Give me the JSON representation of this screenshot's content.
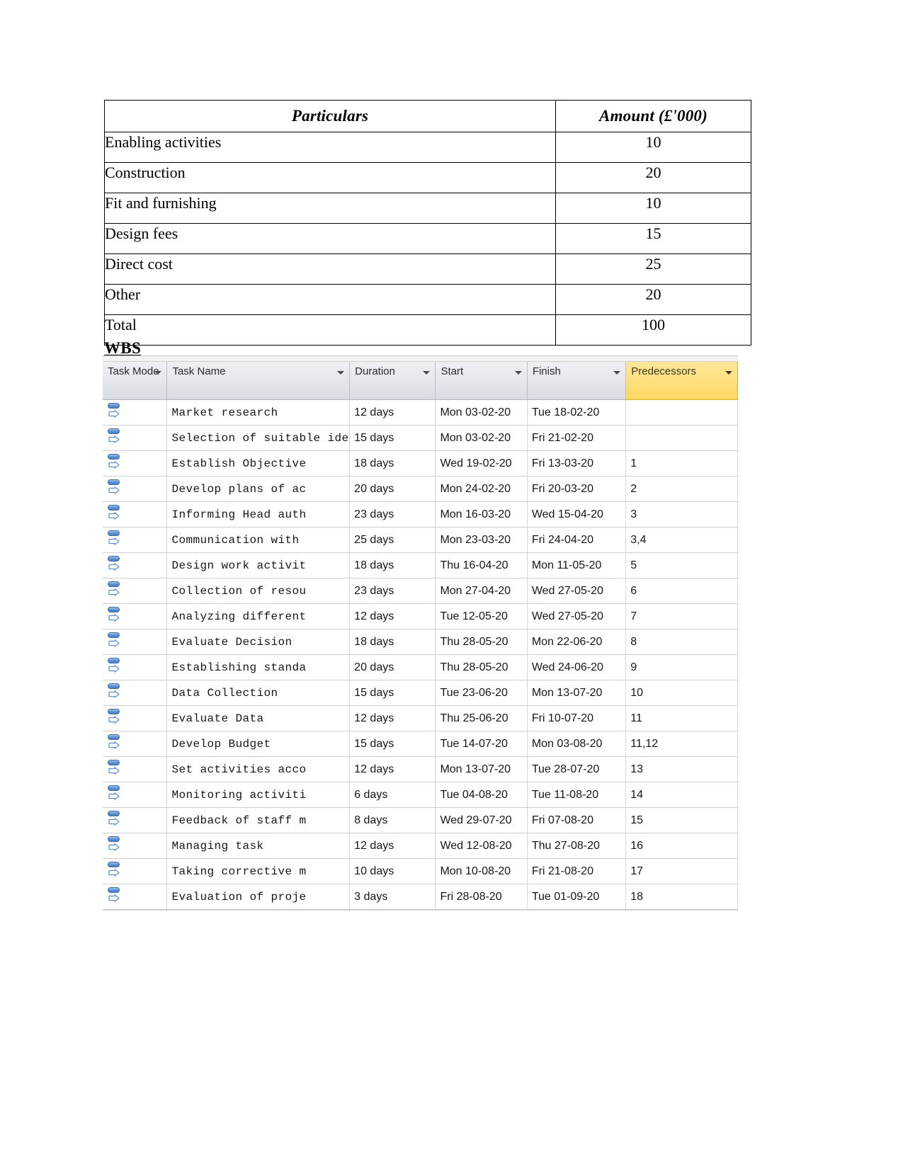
{
  "cost_table": {
    "headers": [
      "Particulars",
      "Amount (£'000)"
    ],
    "rows": [
      {
        "particulars": "Enabling activities",
        "amount": "10"
      },
      {
        "particulars": "Construction",
        "amount": "20"
      },
      {
        "particulars": "Fit and furnishing",
        "amount": "10"
      },
      {
        "particulars": "Design fees",
        "amount": "15"
      },
      {
        "particulars": "Direct cost",
        "amount": "25"
      },
      {
        "particulars": "Other",
        "amount": "20"
      },
      {
        "particulars": "Total",
        "amount": "100"
      }
    ]
  },
  "wbs": {
    "heading": "WBS",
    "colors": {
      "header_background": "#e2e5ea",
      "predecessors_header_background": "#ffde7a",
      "selection_background": "#dde6f3",
      "grid_line": "#d6d6d6"
    },
    "columns": [
      {
        "label": "Task Mode",
        "key": "mode"
      },
      {
        "label": "Task Name",
        "key": "name"
      },
      {
        "label": "Duration",
        "key": "duration"
      },
      {
        "label": "Start",
        "key": "start"
      },
      {
        "label": "Finish",
        "key": "finish"
      },
      {
        "label": "Predecessors",
        "key": "predecessors"
      }
    ],
    "rows": [
      {
        "mode_icon": "auto-scheduled-icon",
        "name": "Market research",
        "duration": "12 days",
        "start": "Mon 03-02-20",
        "finish": "Tue 18-02-20",
        "predecessors": ""
      },
      {
        "mode_icon": "auto-scheduled-icon",
        "name": "Selection of suitable ideas",
        "duration": "15 days",
        "start": "Mon 03-02-20",
        "finish": "Fri 21-02-20",
        "predecessors": ""
      },
      {
        "mode_icon": "auto-scheduled-icon",
        "name": "Establish Objective",
        "duration": "18 days",
        "start": "Wed 19-02-20",
        "finish": "Fri 13-03-20",
        "predecessors": "1"
      },
      {
        "mode_icon": "auto-scheduled-icon",
        "name": "Develop plans of ac",
        "duration": "20 days",
        "start": "Mon 24-02-20",
        "finish": "Fri 20-03-20",
        "predecessors": "2"
      },
      {
        "mode_icon": "auto-scheduled-icon",
        "name": "Informing Head auth",
        "duration": "23 days",
        "start": "Mon 16-03-20",
        "finish": "Wed 15-04-20",
        "predecessors": "3"
      },
      {
        "mode_icon": "auto-scheduled-icon",
        "name": "Communication with",
        "duration": "25 days",
        "start": "Mon 23-03-20",
        "finish": "Fri 24-04-20",
        "predecessors": "3,4"
      },
      {
        "mode_icon": "auto-scheduled-icon",
        "name": "Design work activit",
        "duration": "18 days",
        "start": "Thu 16-04-20",
        "finish": "Mon 11-05-20",
        "predecessors": "5"
      },
      {
        "mode_icon": "auto-scheduled-icon",
        "name": "Collection of resou",
        "duration": "23 days",
        "start": "Mon 27-04-20",
        "finish": "Wed 27-05-20",
        "predecessors": "6"
      },
      {
        "mode_icon": "auto-scheduled-icon",
        "name": "Analyzing different",
        "duration": "12 days",
        "start": "Tue 12-05-20",
        "finish": "Wed 27-05-20",
        "predecessors": "7"
      },
      {
        "mode_icon": "auto-scheduled-icon",
        "name": "Evaluate Decision",
        "duration": "18 days",
        "start": "Thu 28-05-20",
        "finish": "Mon 22-06-20",
        "predecessors": "8"
      },
      {
        "mode_icon": "auto-scheduled-icon",
        "name": "Establishing standa",
        "duration": "20 days",
        "start": "Thu 28-05-20",
        "finish": "Wed 24-06-20",
        "predecessors": "9"
      },
      {
        "mode_icon": "auto-scheduled-icon",
        "name": "Data Collection",
        "duration": "15 days",
        "start": "Tue 23-06-20",
        "finish": "Mon 13-07-20",
        "predecessors": "10"
      },
      {
        "mode_icon": "auto-scheduled-icon",
        "name": "Evaluate Data",
        "duration": "12 days",
        "start": "Thu 25-06-20",
        "finish": "Fri 10-07-20",
        "predecessors": "11"
      },
      {
        "mode_icon": "auto-scheduled-icon",
        "name": "Develop Budget",
        "duration": "15 days",
        "start": "Tue 14-07-20",
        "finish": "Mon 03-08-20",
        "predecessors": "11,12"
      },
      {
        "mode_icon": "auto-scheduled-icon",
        "name": "Set activities acco",
        "duration": "12 days",
        "start": "Mon 13-07-20",
        "finish": "Tue 28-07-20",
        "predecessors": "13"
      },
      {
        "mode_icon": "auto-scheduled-icon",
        "name": "Monitoring activiti",
        "duration": "6 days",
        "start": "Tue 04-08-20",
        "finish": "Tue 11-08-20",
        "predecessors": "14"
      },
      {
        "mode_icon": "auto-scheduled-icon",
        "name": "Feedback of staff m",
        "duration": "8 days",
        "start": "Wed 29-07-20",
        "finish": "Fri 07-08-20",
        "predecessors": "15"
      },
      {
        "mode_icon": "auto-scheduled-icon",
        "name": "Managing task",
        "duration": "12 days",
        "start": "Wed 12-08-20",
        "finish": "Thu 27-08-20",
        "predecessors": "16"
      },
      {
        "mode_icon": "auto-scheduled-icon",
        "name": "Taking corrective m",
        "duration": "10 days",
        "start": "Mon 10-08-20",
        "finish": "Fri 21-08-20",
        "predecessors": "17"
      },
      {
        "mode_icon": "auto-scheduled-icon",
        "name": "Evaluation of proje",
        "duration": "3 days",
        "start": "Fri 28-08-20",
        "finish": "Tue 01-09-20",
        "predecessors": "18",
        "selected_cells": [
          "start",
          "finish"
        ]
      }
    ]
  }
}
